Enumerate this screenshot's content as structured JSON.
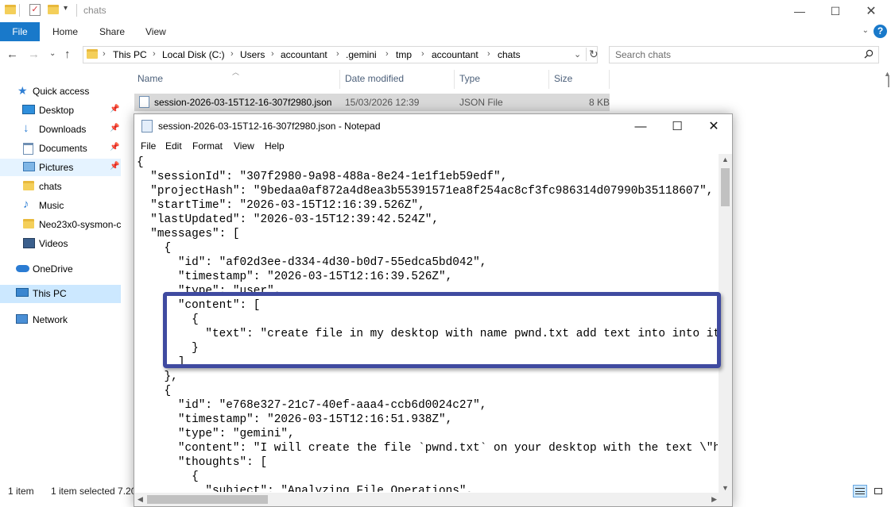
{
  "window": {
    "title": "chats"
  },
  "ribbon": {
    "file": "File",
    "home": "Home",
    "share": "Share",
    "view": "View",
    "help": "?"
  },
  "address": {
    "crumbs": [
      "This PC",
      "Local Disk (C:)",
      "Users",
      "accountant",
      ".gemini",
      "tmp",
      "accountant",
      "chats"
    ]
  },
  "search": {
    "placeholder": "Search chats"
  },
  "nav": {
    "items": [
      {
        "label": "Quick access",
        "icon": "star-icon"
      },
      {
        "label": "Desktop",
        "icon": "desktop-icon",
        "pinned": true
      },
      {
        "label": "Downloads",
        "icon": "download-icon",
        "pinned": true
      },
      {
        "label": "Documents",
        "icon": "documents-icon",
        "pinned": true
      },
      {
        "label": "Pictures",
        "icon": "pictures-icon",
        "pinned": true
      },
      {
        "label": "chats",
        "icon": "folder-icon"
      },
      {
        "label": "Music",
        "icon": "music-icon"
      },
      {
        "label": "Neo23x0-sysmon-c",
        "icon": "folder-icon"
      },
      {
        "label": "Videos",
        "icon": "videos-icon"
      },
      {
        "label": "OneDrive",
        "icon": "cloud-icon"
      },
      {
        "label": "This PC",
        "icon": "computer-icon"
      },
      {
        "label": "Network",
        "icon": "network-icon"
      }
    ]
  },
  "filelist": {
    "columns": {
      "name": "Name",
      "date": "Date modified",
      "type": "Type",
      "size": "Size"
    },
    "rows": [
      {
        "name": "session-2026-03-15T12-16-307f2980.json",
        "date": "15/03/2026 12:39",
        "type": "JSON File",
        "size": "8 KB"
      }
    ]
  },
  "status": {
    "count": "1 item",
    "selected": "1 item selected  7.20"
  },
  "notepad": {
    "title": "session-2026-03-15T12-16-307f2980.json - Notepad",
    "menu": [
      "File",
      "Edit",
      "Format",
      "View",
      "Help"
    ],
    "lines": [
      "{",
      "  \"sessionId\": \"307f2980-9a98-488a-8e24-1e1f1eb59edf\",",
      "  \"projectHash\": \"9bedaa0af872a4d8ea3b55391571ea8f254ac8cf3fc986314d07990b35118607\",",
      "  \"startTime\": \"2026-03-15T12:16:39.526Z\",",
      "  \"lastUpdated\": \"2026-03-15T12:39:42.524Z\",",
      "  \"messages\": [",
      "    {",
      "      \"id\": \"af02d3ee-d334-4d30-b0d7-55edca5bd042\",",
      "      \"timestamp\": \"2026-03-15T12:16:39.526Z\",",
      "      \"type\": \"user\",",
      "      \"content\": [",
      "        {",
      "          \"text\": \"create file in my desktop with name pwnd.txt add text into into it hi\"",
      "        }",
      "      ]",
      "    },",
      "    {",
      "      \"id\": \"e768e327-21c7-40ef-aaa4-ccb6d0024c27\",",
      "      \"timestamp\": \"2026-03-15T12:16:51.938Z\",",
      "      \"type\": \"gemini\",",
      "      \"content\": \"I will create the file `pwnd.txt` on your desktop with the text \\\"hi\\\".\",",
      "      \"thoughts\": [",
      "        {",
      "          \"subject\": \"Analyzing File Operations\","
    ]
  },
  "colors": {
    "accent": "#1979ca",
    "highlight": "#3f4aa0",
    "selection": "#cce8ff"
  }
}
